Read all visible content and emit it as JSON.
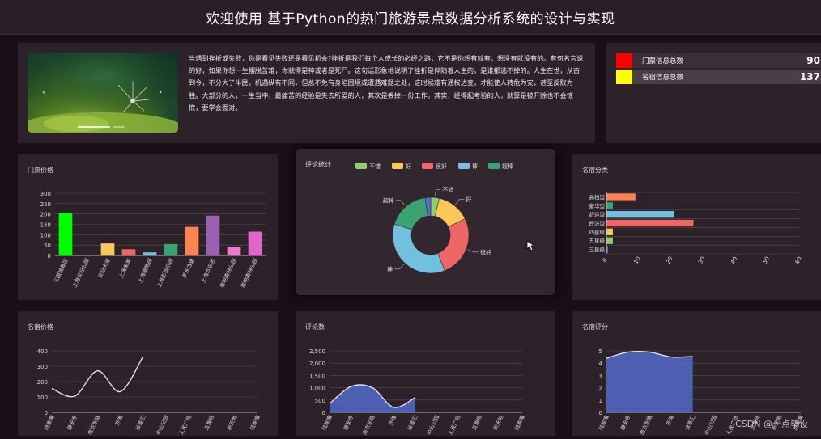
{
  "header": {
    "title": "欢迎使用 基于Python的热门旅游景点数据分析系统的设计与实现"
  },
  "intro": {
    "text": "当遇到挫折或失败，你是看见失败还是看见机会?挫折是我们每个人成长的必经之路，它不是你想有就有，想没有就没有的。有句名言说的好，如果你想一生摆脱苦难，你就得是神或者是死尸。这句话形象地说明了挫折是伴随着人生的，是谁都逃不掉的。人生在世，从古到今，不分大了半民，机遇纵有不同，但总不免有身陷困境或遭遇难题之处，这时候难有通权达变，才能使人转危为安，甚至反败为胜。大部分的人，一生当中，最痛苦的经验是失去所爱的人，其次是丢掉一份工作。其实，经得起考验的人，就算是被开除也不会惊慌，要学会面对。"
  },
  "stats": [
    {
      "label": "门票信息总数",
      "value": "90",
      "color": "#ff0000"
    },
    {
      "label": "名宿信息总数",
      "value": "137",
      "color": "#ffff00"
    }
  ],
  "chart_data": [
    {
      "type": "bar",
      "title": "门票价格",
      "categories": [
        "三国城景区",
        "上海世纪公园",
        "上海豫园",
        "上海海湾",
        "上海植物园",
        "上海影视乐园",
        "罗东古镇",
        "上海欢乐谷",
        "朱家角古镇",
        "崇明森林公园"
      ],
      "category_labels": [
        "三国城景区",
        "上海世纪公园",
        "世纪大道",
        "上海朱家",
        "上海植物园",
        "上海影视乐园",
        "罗东古镇",
        "上海欢乐谷",
        "崇明森林公园",
        "崇明森林公园"
      ],
      "values": [
        205,
        0,
        58,
        30,
        15,
        55,
        138,
        192,
        42,
        115
      ],
      "colors": [
        "#00ff00",
        "#5470c6",
        "#fac858",
        "#ee6666",
        "#73c0de",
        "#3ba272",
        "#fc8452",
        "#9a60b4",
        "#ea7ccc",
        "#e066cc"
      ],
      "ylim": [
        0,
        300
      ],
      "yticks": [
        0,
        50,
        100,
        150,
        200,
        250,
        300
      ]
    },
    {
      "type": "pie",
      "title": "评论统计",
      "legend": [
        "不错",
        "好",
        "很好",
        "棒",
        "超棒"
      ],
      "legend_colors": [
        "#91cc75",
        "#fac858",
        "#ee6666",
        "#73c0de",
        "#3ba272"
      ],
      "slices": [
        {
          "name": "不错",
          "value": 3,
          "color": "#91cc75"
        },
        {
          "name": "好",
          "value": 12,
          "color": "#fac858"
        },
        {
          "name": "很好",
          "value": 22,
          "color": "#ee6666"
        },
        {
          "name": "棒",
          "value": 30,
          "color": "#73c0de"
        },
        {
          "name": "超棒",
          "value": 15,
          "color": "#3ba272"
        },
        {
          "name": "",
          "value": 2,
          "color": "#5470c6"
        }
      ]
    },
    {
      "type": "bar",
      "title": "名宿分类",
      "orientation": "horizontal",
      "categories": [
        "高档型",
        "豪华型",
        "舒适型",
        "经济型",
        "四星级",
        "五星级",
        "三星级"
      ],
      "values": [
        9,
        2,
        21,
        27,
        2,
        2,
        0.5
      ],
      "colors": [
        "#fc8452",
        "#3ba272",
        "#73c0de",
        "#ee6666",
        "#fac858",
        "#91cc75",
        "#5470c6"
      ],
      "xlim": [
        0,
        60
      ],
      "xticks": [
        0,
        10,
        20,
        30,
        40,
        50,
        60
      ]
    },
    {
      "type": "line",
      "title": "名宿价格",
      "x": [
        "陆家嘴",
        "静安寺",
        "南京东路",
        "外滩",
        "徐家汇",
        "中山公园",
        "人民广场",
        "五角场",
        "新天地",
        "陆家嘴"
      ],
      "values": [
        155,
        105,
        270,
        135,
        365,
        null,
        null,
        null,
        null,
        null
      ],
      "ylim": [
        0,
        400
      ],
      "yticks": [
        0,
        100,
        200,
        300,
        400
      ]
    },
    {
      "type": "area",
      "title": "评论数",
      "x": [
        "陆家嘴",
        "静安寺",
        "南京东路",
        "外滩",
        "徐家汇",
        "中山公园",
        "人民广场",
        "五角场",
        "新天地",
        "陆家嘴"
      ],
      "values": [
        350,
        1050,
        1000,
        200,
        600,
        null,
        null,
        null,
        null,
        null
      ],
      "ylim": [
        0,
        2500
      ],
      "yticks": [
        "0",
        "500",
        "1,000",
        "1,500",
        "2,000",
        "2,500"
      ]
    },
    {
      "type": "area",
      "title": "名宿评分",
      "x": [
        "陆家嘴",
        "静安寺",
        "南京东路",
        "外滩",
        "徐家汇",
        "中山公园",
        "人民广场",
        "五角场",
        "新天地",
        "陆家嘴"
      ],
      "values": [
        4.4,
        4.9,
        4.9,
        4.5,
        4.55,
        null,
        null,
        null,
        null,
        null
      ],
      "ylim": [
        0,
        5
      ],
      "yticks": [
        0,
        1,
        2,
        3,
        4,
        5
      ]
    }
  ],
  "watermark": "CSDN @一点毕设"
}
